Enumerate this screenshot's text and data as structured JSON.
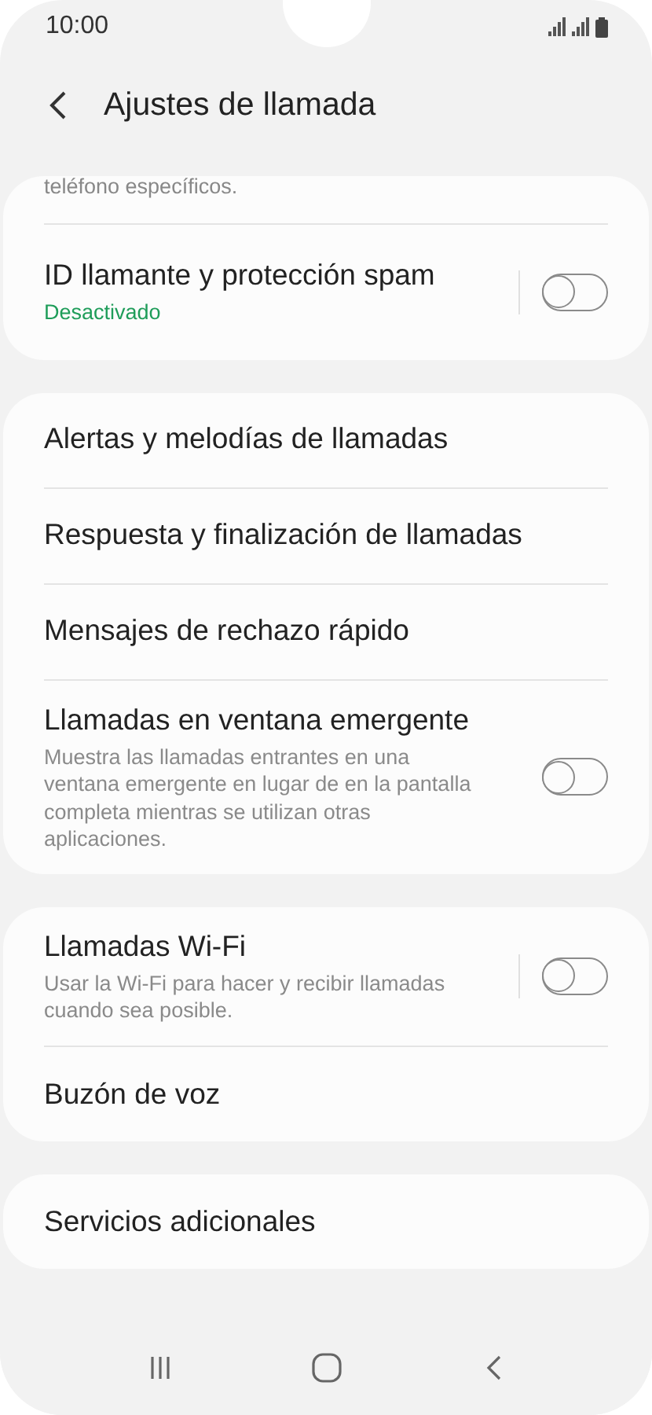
{
  "status_bar": {
    "time": "10:00"
  },
  "header": {
    "title": "Ajustes de llamada"
  },
  "groups": [
    {
      "items": [
        {
          "kind": "fragment",
          "title": "teléfono específicos."
        },
        {
          "kind": "toggle",
          "title": "ID llamante y protección spam",
          "subtitle": "Desactivado",
          "subtitle_accent": true,
          "on": false,
          "split": true
        }
      ]
    },
    {
      "items": [
        {
          "kind": "link",
          "title": "Alertas y melodías de llamadas"
        },
        {
          "kind": "link",
          "title": "Respuesta y finalización de llamadas"
        },
        {
          "kind": "link",
          "title": "Mensajes de rechazo rápido"
        },
        {
          "kind": "toggle",
          "title": "Llamadas en ventana emergente",
          "subtitle": "Muestra las llamadas entrantes en una ventana emergente en lugar de en la pantalla completa mientras se utilizan otras aplicaciones.",
          "subtitle_accent": false,
          "on": false,
          "split": false
        }
      ]
    },
    {
      "items": [
        {
          "kind": "toggle",
          "title": "Llamadas Wi-Fi",
          "subtitle": "Usar la Wi-Fi para hacer y recibir llamadas cuando sea posible.",
          "subtitle_accent": false,
          "on": false,
          "split": true
        },
        {
          "kind": "link",
          "title": "Buzón de voz"
        }
      ]
    },
    {
      "items": [
        {
          "kind": "link",
          "title": "Servicios adicionales"
        }
      ]
    }
  ]
}
